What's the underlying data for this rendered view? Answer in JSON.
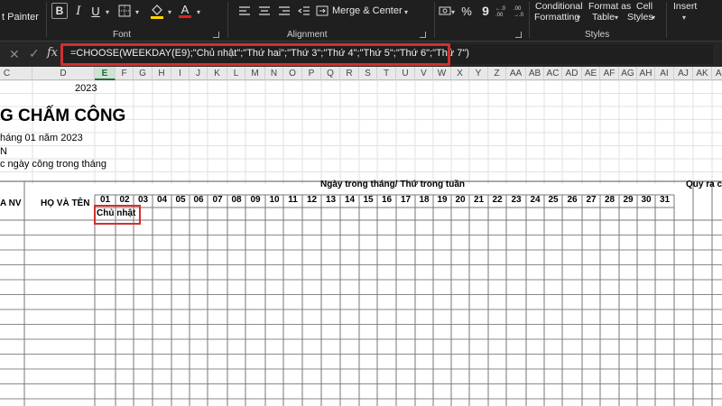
{
  "ribbon": {
    "format_painter_label": "t Painter",
    "groups": {
      "font": "Font",
      "alignment": "Alignment",
      "styles": "Styles"
    },
    "bold_label": "B",
    "italic_label": "I",
    "underline_label": "U",
    "font_color_glyph": "A",
    "merge_center_label": "Merge & Center",
    "percent_label": "%",
    "comma_label": "9",
    "conditional_formatting": [
      "Conditional",
      "Formatting"
    ],
    "format_as_table": [
      "Format as",
      "Table"
    ],
    "cell_styles": [
      "Cell",
      "Styles"
    ],
    "insert_label": "Insert",
    "accent": "#d32f2f"
  },
  "formula_bar": {
    "fx_label": "fx",
    "formula": "=CHOOSE(WEEKDAY(E9);\"Chủ nhật\";\"Thứ hai\";\"Thứ 3\";\"Thứ 4\";\"Thứ 5\";\"Thứ 6\";\"Thứ 7\")"
  },
  "columns": [
    "C",
    "D",
    "E",
    "F",
    "G",
    "H",
    "I",
    "J",
    "K",
    "L",
    "M",
    "N",
    "O",
    "P",
    "Q",
    "R",
    "S",
    "T",
    "U",
    "V",
    "W",
    "X",
    "Y",
    "Z",
    "AA",
    "AB",
    "AC",
    "AD",
    "AE",
    "AF",
    "AG",
    "AH",
    "AI",
    "AJ",
    "AK",
    "AL"
  ],
  "selected_column": "E",
  "sheet": {
    "year": "2023",
    "title": "G CHẤM CÔNG",
    "subtitle": "háng 01 năm 2023",
    "line3": "N",
    "line4": "c ngày công trong tháng",
    "ma_nv": "A NV",
    "ho_va_ten": "HỌ VÀ TÊN",
    "days_header": "Ngày trong tháng/ Thứ trong tuần",
    "quy_ra": "Quy ra c",
    "days": [
      "01",
      "02",
      "03",
      "04",
      "05",
      "06",
      "07",
      "08",
      "09",
      "10",
      "11",
      "12",
      "13",
      "14",
      "15",
      "16",
      "17",
      "18",
      "19",
      "20",
      "21",
      "22",
      "23",
      "24",
      "25",
      "26",
      "27",
      "28",
      "29",
      "30",
      "31"
    ],
    "result": "Chủ nhật"
  }
}
